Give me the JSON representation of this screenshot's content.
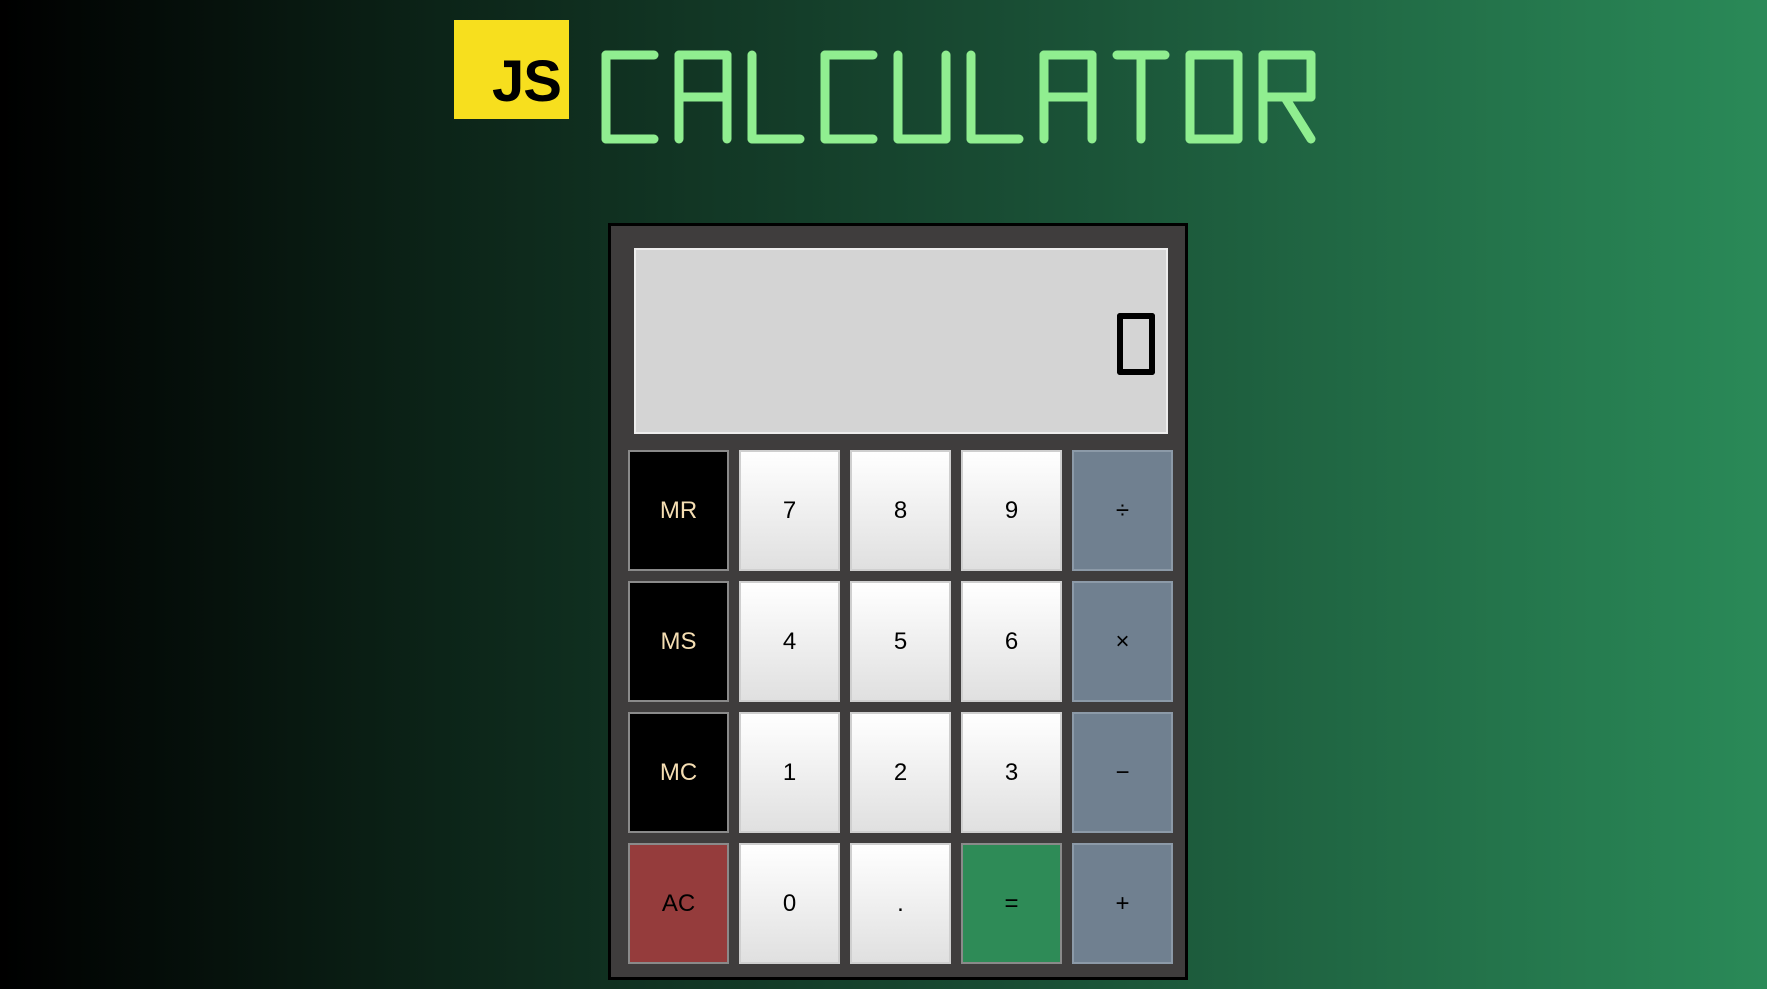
{
  "header": {
    "logo_text": "JS",
    "title": "CALCULATOR",
    "title_color": "#90ee90",
    "logo_color": "#f7df1e"
  },
  "display": {
    "value": "0"
  },
  "keys": [
    {
      "label": "MR",
      "kind": "mem",
      "name": "memory-recall-button"
    },
    {
      "label": "7",
      "kind": "num",
      "name": "digit-7-button"
    },
    {
      "label": "8",
      "kind": "num",
      "name": "digit-8-button"
    },
    {
      "label": "9",
      "kind": "num",
      "name": "digit-9-button"
    },
    {
      "label": "÷",
      "kind": "op",
      "name": "divide-button"
    },
    {
      "label": "MS",
      "kind": "mem",
      "name": "memory-store-button"
    },
    {
      "label": "4",
      "kind": "num",
      "name": "digit-4-button"
    },
    {
      "label": "5",
      "kind": "num",
      "name": "digit-5-button"
    },
    {
      "label": "6",
      "kind": "num",
      "name": "digit-6-button"
    },
    {
      "label": "×",
      "kind": "op",
      "name": "multiply-button"
    },
    {
      "label": "MC",
      "kind": "mem",
      "name": "memory-clear-button"
    },
    {
      "label": "1",
      "kind": "num",
      "name": "digit-1-button"
    },
    {
      "label": "2",
      "kind": "num",
      "name": "digit-2-button"
    },
    {
      "label": "3",
      "kind": "num",
      "name": "digit-3-button"
    },
    {
      "label": "−",
      "kind": "op",
      "name": "subtract-button"
    },
    {
      "label": "AC",
      "kind": "clear",
      "name": "all-clear-button"
    },
    {
      "label": "0",
      "kind": "num",
      "name": "digit-0-button"
    },
    {
      "label": ".",
      "kind": "num",
      "name": "decimal-point-button"
    },
    {
      "label": "=",
      "kind": "eq",
      "name": "equals-button"
    },
    {
      "label": "+",
      "kind": "op",
      "name": "add-button"
    }
  ],
  "colors": {
    "mem_bg": "#000000",
    "mem_text": "#f5deb3",
    "op_bg": "#708090",
    "clear_bg": "#953c3c",
    "equals_bg": "#2e8b57",
    "display_bg": "#d4d4d4"
  }
}
